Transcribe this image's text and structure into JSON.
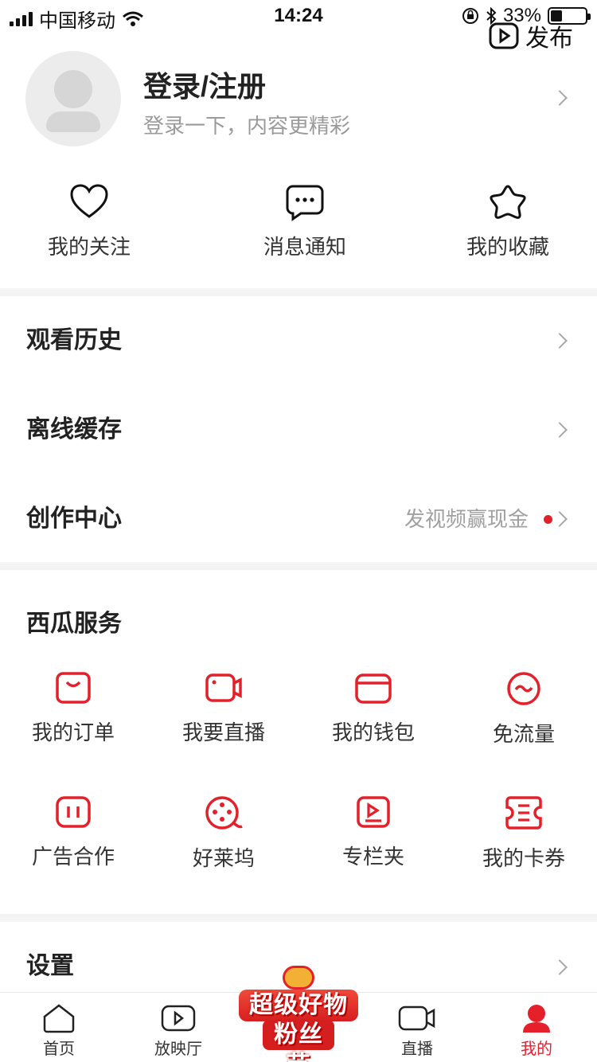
{
  "status_bar": {
    "carrier": "中国移动",
    "time": "14:24",
    "battery": "33%",
    "battery_level": 0.33
  },
  "header": {
    "publish_label": "发布"
  },
  "profile": {
    "title": "登录/注册",
    "subtitle": "登录一下，内容更精彩"
  },
  "quick_actions": [
    {
      "label": "我的关注",
      "icon": "heart-icon"
    },
    {
      "label": "消息通知",
      "icon": "chat-bubble-icon"
    },
    {
      "label": "我的收藏",
      "icon": "star-icon"
    }
  ],
  "menu": {
    "history": {
      "label": "观看历史"
    },
    "offline": {
      "label": "离线缓存"
    },
    "creator": {
      "label": "创作中心",
      "hint": "发视频赢现金"
    },
    "settings": {
      "label": "设置"
    }
  },
  "services": {
    "title": "西瓜服务",
    "items": [
      {
        "label": "我的订单",
        "icon": "order-icon"
      },
      {
        "label": "我要直播",
        "icon": "live-camera-icon"
      },
      {
        "label": "我的钱包",
        "icon": "wallet-icon"
      },
      {
        "label": "免流量",
        "icon": "free-data-icon"
      },
      {
        "label": "广告合作",
        "icon": "ad-cooperation-icon"
      },
      {
        "label": "好莱坞",
        "icon": "film-reel-icon"
      },
      {
        "label": "专栏夹",
        "icon": "column-folder-icon"
      },
      {
        "label": "我的卡券",
        "icon": "coupon-icon"
      }
    ]
  },
  "tabbar": {
    "tabs": [
      {
        "label": "首页",
        "icon": "home-icon"
      },
      {
        "label": "放映厅",
        "icon": "play-screen-icon"
      },
      {
        "label": "直播",
        "icon": "video-camera-icon"
      },
      {
        "label": "我的",
        "icon": "profile-icon"
      }
    ],
    "promo": {
      "line1": "超级好物",
      "line2": "粉丝节"
    }
  },
  "colors": {
    "accent": "#e4202a",
    "text": "#222222",
    "muted": "#9a9a9a",
    "separator": "#f4f4f4"
  }
}
